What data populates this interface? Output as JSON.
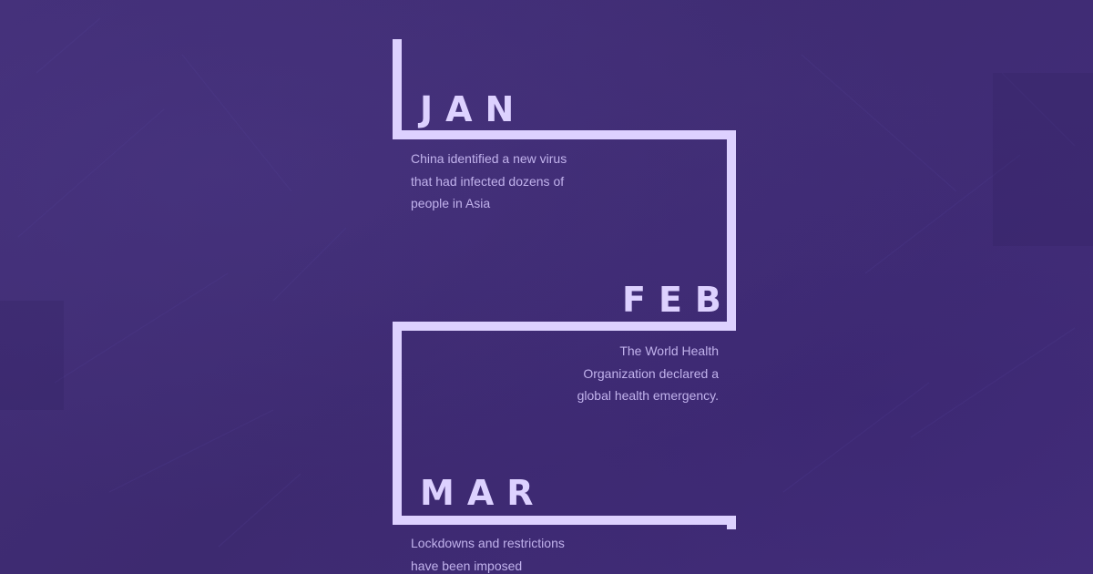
{
  "colors": {
    "background": "#3f2d73",
    "line": "#ddd1ff",
    "month_text": "#ddd1ff",
    "description_text": "#c1b2ec"
  },
  "timeline": {
    "items": [
      {
        "month": "JAN",
        "line1": "China identified a new virus",
        "line2": "that had infected dozens of",
        "line3": "people in Asia"
      },
      {
        "month": "FEB",
        "line1": "The World Health",
        "line2": "Organization declared a",
        "line3": "global health emergency."
      },
      {
        "month": "MAR",
        "line1": "Lockdowns and restrictions",
        "line2": "have been imposed"
      }
    ]
  }
}
